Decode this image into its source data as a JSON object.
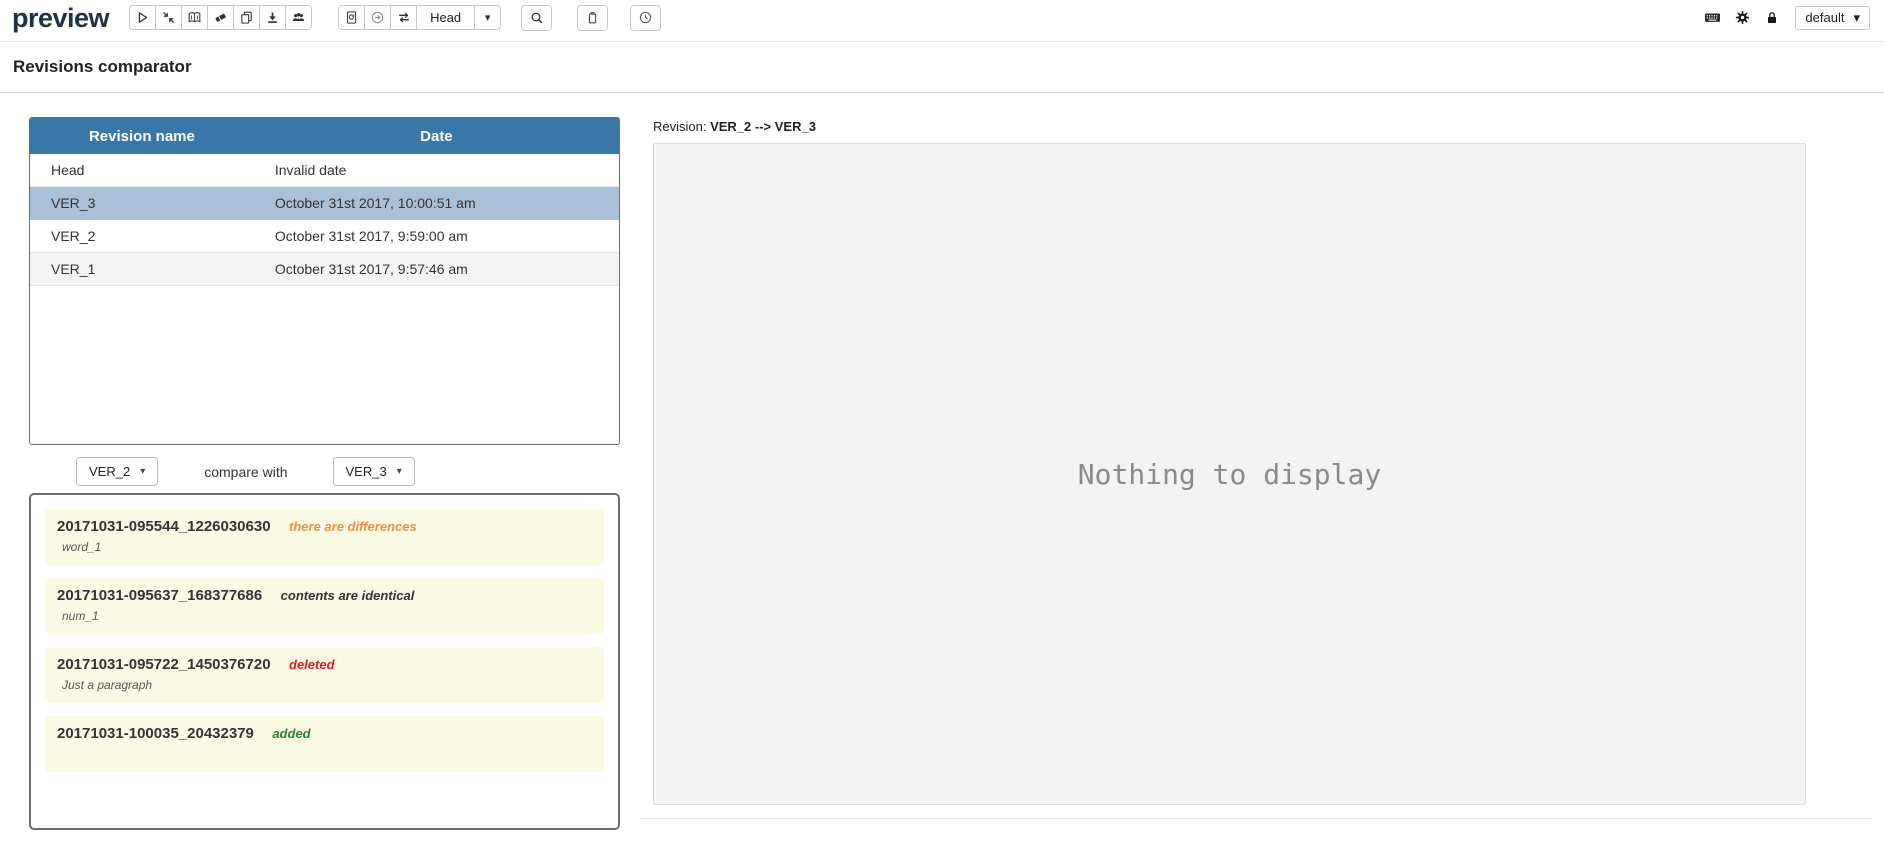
{
  "app": {
    "logo": "preview"
  },
  "icons": {
    "caret_down": "▾"
  },
  "toolbar": {
    "head_select_value": "Head",
    "group1": [
      "play",
      "compress",
      "book",
      "eraser",
      "copy",
      "download",
      "users"
    ],
    "group2": [
      "document-refresh",
      "circle-arrow",
      "swap"
    ],
    "standalone": [
      "search",
      "trash",
      "clock"
    ]
  },
  "topbar_right": {
    "icons": [
      "keyboard",
      "gear",
      "lock"
    ],
    "default_select_value": "default"
  },
  "page": {
    "title": "Revisions comparator"
  },
  "revisions_table": {
    "columns": [
      "Revision name",
      "Date"
    ],
    "rows": [
      {
        "name": "Head",
        "date": "Invalid date",
        "selected": false
      },
      {
        "name": "VER_3",
        "date": "October 31st 2017, 10:00:51 am",
        "selected": true
      },
      {
        "name": "VER_2",
        "date": "October 31st 2017, 9:59:00 am",
        "selected": false
      },
      {
        "name": "VER_1",
        "date": "October 31st 2017, 9:57:46 am",
        "selected": false
      }
    ]
  },
  "compare": {
    "left_value": "VER_2",
    "label": "compare with",
    "right_value": "VER_3"
  },
  "diff_list": [
    {
      "id": "20171031-095544_1226030630",
      "status": "there are differences",
      "status_color": "#ef8e3e",
      "subtitle": "word_1"
    },
    {
      "id": "20171031-095637_168377686",
      "status": "contents are identical",
      "status_color": "#333333",
      "subtitle": "num_1"
    },
    {
      "id": "20171031-095722_1450376720",
      "status": "deleted",
      "status_color": "#e01b1b",
      "subtitle": "Just a paragraph"
    },
    {
      "id": "20171031-100035_20432379",
      "status": "added",
      "status_color": "#2e7d32",
      "subtitle": ""
    }
  ],
  "preview_panel": {
    "revision_label": "Revision:",
    "revision_value": "VER_2 --> VER_3",
    "empty_message": "Nothing to display"
  },
  "colors": {
    "table_header": "#3a76a8",
    "selected_row": "#a9c0d8",
    "row_stripe": "#f4f4f4",
    "item_bg": "#fbfbe5",
    "status_differences": "#ef8e3e",
    "status_identical": "#333333",
    "status_deleted": "#e01b1b",
    "status_added": "#2e7d32",
    "empty_text": "#8a8a8a",
    "logo": "#233243"
  }
}
